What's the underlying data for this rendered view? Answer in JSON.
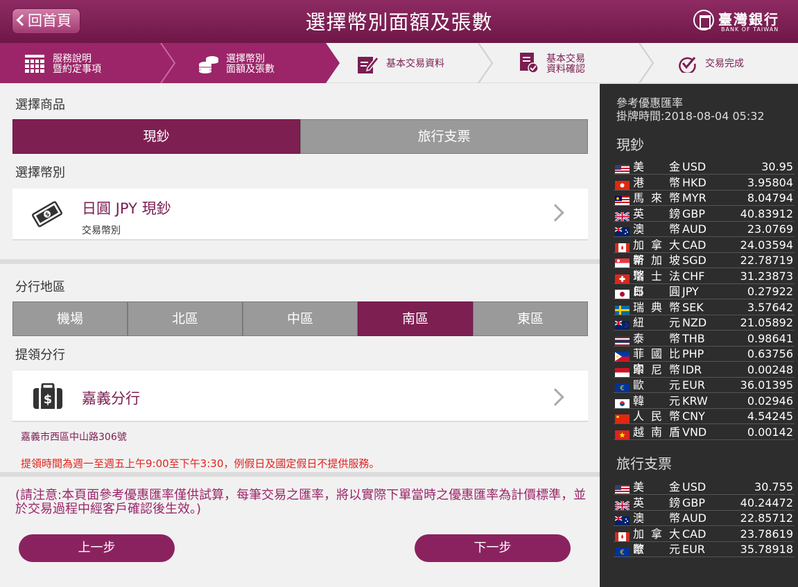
{
  "header": {
    "back_label": "回首頁",
    "title": "選擇幣別面額及張數",
    "logo_name": "臺灣銀行",
    "logo_eng": "BANK OF TAIWAN"
  },
  "steps": [
    {
      "line1": "服務說明",
      "line2": "暨約定事項",
      "icon": "grid-icon"
    },
    {
      "line1": "選擇幣別",
      "line2": "面額及張數",
      "icon": "coins-icon"
    },
    {
      "line1": "基本交易資料",
      "line2": "",
      "icon": "edit-form-icon"
    },
    {
      "line1": "基本交易",
      "line2": "資料確認",
      "icon": "document-check-icon"
    },
    {
      "line1": "交易完成",
      "line2": "",
      "icon": "check-circle-icon"
    }
  ],
  "product": {
    "label": "選擇商品",
    "options": [
      "現鈔",
      "旅行支票"
    ],
    "selected": "現鈔"
  },
  "currency": {
    "label": "選擇幣別",
    "value": "日圓 JPY 現鈔",
    "sub": "交易幣別"
  },
  "region": {
    "label": "分行地區",
    "options": [
      "機場",
      "北區",
      "中區",
      "南區",
      "東區"
    ],
    "selected": "南區"
  },
  "branch": {
    "label": "提領分行",
    "value": "嘉義分行",
    "address": "嘉義市西區中山路306號",
    "hours": "提領時間為週一至週五上午9:00至下午3:30，例假日及國定假日不提供服務。"
  },
  "notice": "(請注意:本頁面參考優惠匯率僅供試算，每筆交易之匯率，將以實際下單當時之優惠匯率為計價標準，並於交易過程中經客戶確認後生效。)",
  "buttons": {
    "prev": "上一步",
    "next": "下一步"
  },
  "rates_panel": {
    "title": "參考優惠匯率",
    "time": "掛牌時間:2018-08-04 05:32",
    "cash_label": "現鈔",
    "cash": [
      {
        "name": "美金",
        "code": "USD",
        "value": "30.95",
        "flag": "us"
      },
      {
        "name": "港幣",
        "code": "HKD",
        "value": "3.95804",
        "flag": "hk"
      },
      {
        "name": "馬來幣",
        "code": "MYR",
        "value": "8.04794",
        "flag": "my"
      },
      {
        "name": "英鎊",
        "code": "GBP",
        "value": "40.83912",
        "flag": "gb"
      },
      {
        "name": "澳幣",
        "code": "AUD",
        "value": "23.0769",
        "flag": "au"
      },
      {
        "name": "加拿大幣",
        "code": "CAD",
        "value": "24.03594",
        "flag": "ca"
      },
      {
        "name": "新加坡幣",
        "code": "SGD",
        "value": "22.78719",
        "flag": "sg"
      },
      {
        "name": "瑞士法郎",
        "code": "CHF",
        "value": "31.23873",
        "flag": "ch"
      },
      {
        "name": "日圓",
        "code": "JPY",
        "value": "0.27922",
        "flag": "jp"
      },
      {
        "name": "瑞典幣",
        "code": "SEK",
        "value": "3.57642",
        "flag": "se"
      },
      {
        "name": "紐元",
        "code": "NZD",
        "value": "21.05892",
        "flag": "nz"
      },
      {
        "name": "泰幣",
        "code": "THB",
        "value": "0.98641",
        "flag": "th"
      },
      {
        "name": "菲國比索",
        "code": "PHP",
        "value": "0.63756",
        "flag": "ph"
      },
      {
        "name": "印尼幣",
        "code": "IDR",
        "value": "0.00248",
        "flag": "id"
      },
      {
        "name": "歐元",
        "code": "EUR",
        "value": "36.01395",
        "flag": "eu"
      },
      {
        "name": "韓元",
        "code": "KRW",
        "value": "0.02946",
        "flag": "kr"
      },
      {
        "name": "人民幣",
        "code": "CNY",
        "value": "4.54245",
        "flag": "cn"
      },
      {
        "name": "越南盾",
        "code": "VND",
        "value": "0.00142",
        "flag": "vn"
      }
    ],
    "tc_label": "旅行支票",
    "tc": [
      {
        "name": "美金",
        "code": "USD",
        "value": "30.755",
        "flag": "us"
      },
      {
        "name": "英鎊",
        "code": "GBP",
        "value": "40.24472",
        "flag": "gb"
      },
      {
        "name": "澳幣",
        "code": "AUD",
        "value": "22.85712",
        "flag": "au"
      },
      {
        "name": "加拿大幣",
        "code": "CAD",
        "value": "23.78619",
        "flag": "ca"
      },
      {
        "name": "歐元",
        "code": "EUR",
        "value": "35.78918",
        "flag": "eu"
      }
    ]
  }
}
